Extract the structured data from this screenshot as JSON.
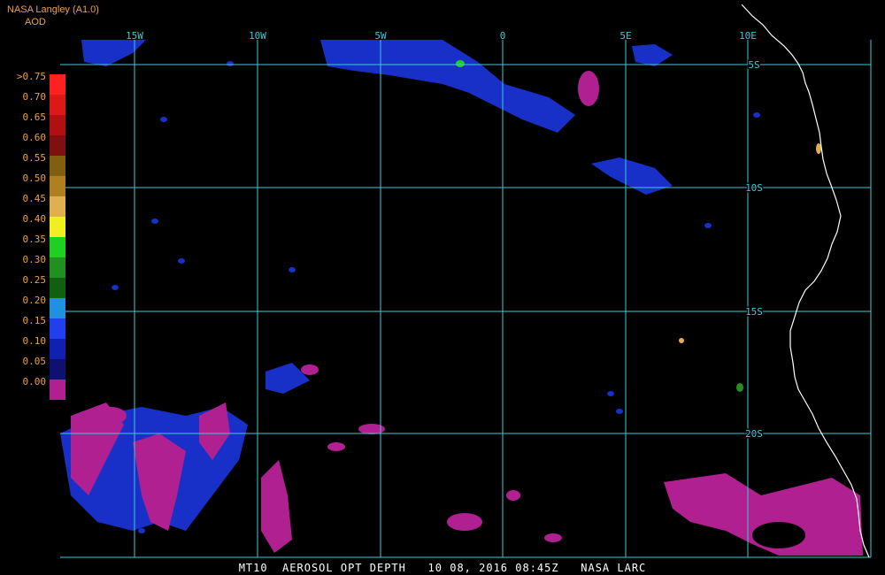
{
  "header": {
    "product": "NASA Langley (A1.0)",
    "parameter": "AOD"
  },
  "legend": {
    "entries": [
      {
        "label": ">0.75",
        "color": "#ff2020"
      },
      {
        "label": "0.70",
        "color": "#dd1818"
      },
      {
        "label": "0.65",
        "color": "#b01010"
      },
      {
        "label": "0.60",
        "color": "#801010"
      },
      {
        "label": "0.55",
        "color": "#806010"
      },
      {
        "label": "0.50",
        "color": "#b08020"
      },
      {
        "label": "0.45",
        "color": "#e0b050"
      },
      {
        "label": "0.40",
        "color": "#f0f020"
      },
      {
        "label": "0.35",
        "color": "#20d020"
      },
      {
        "label": "0.30",
        "color": "#209020"
      },
      {
        "label": "0.25",
        "color": "#106010"
      },
      {
        "label": "0.20",
        "color": "#2090e0"
      },
      {
        "label": "0.15",
        "color": "#2040f0"
      },
      {
        "label": "0.10",
        "color": "#1020b0"
      },
      {
        "label": "0.05",
        "color": "#101070"
      },
      {
        "label": "0.00",
        "color": "#b02090"
      }
    ]
  },
  "grid": {
    "lon_labels": [
      "15W",
      "10W",
      "5W",
      "0",
      "5E",
      "10E"
    ],
    "lat_labels": [
      "5S",
      "10S",
      "15S",
      "20S"
    ],
    "line_color": "#40c8d8"
  },
  "footer": {
    "text": "MT10  AEROSOL OPT DEPTH   10 08, 2016 08:45Z   NASA LARC"
  },
  "colors": {
    "coastline": "#ffffff",
    "low_aod": "#b02090",
    "blue_aod": "#1830c8"
  }
}
